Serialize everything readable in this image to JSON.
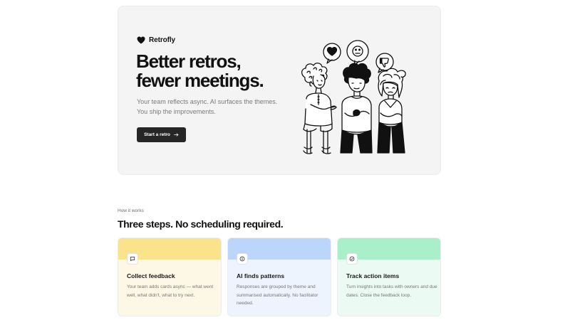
{
  "hero": {
    "brand_name": "Retrofly",
    "brand_icon": "heart-icon",
    "headline_line1": "Better retros,",
    "headline_line2": "fewer meetings.",
    "subtext": "Your team reflects async. AI surfaces the themes. You ship the improvements.",
    "cta_label": "Start a retro",
    "cta_icon": "arrow-right-icon"
  },
  "how": {
    "eyebrow": "How it works",
    "title": "Three steps. No scheduling required."
  },
  "steps": [
    {
      "title": "Collect feedback",
      "description": "Your team adds cards async — what went well, what didn't, what to try next.",
      "icon": "chat-bubble-icon",
      "accent": "#fbe38b",
      "background": "#fdf8e5"
    },
    {
      "title": "AI finds patterns",
      "description": "Responses are grouped by theme and summarised automatically. No facilitator needed.",
      "icon": "info-icon",
      "accent": "#bcd6fb",
      "background": "#eef4fd"
    },
    {
      "title": "Track action items",
      "description": "Turn insights into tasks with owners and due dates. Close the feedback loop.",
      "icon": "check-circle-icon",
      "accent": "#a9efca",
      "background": "#ebfaf2"
    }
  ],
  "colors": {
    "hero_background": "#f4f4f4",
    "button": "#262626",
    "text": "#111111",
    "muted_text": "#7a7a7a"
  }
}
